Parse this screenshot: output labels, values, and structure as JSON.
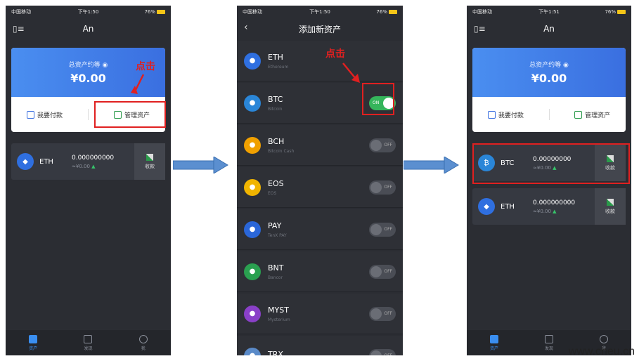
{
  "status": {
    "carrier": "中国移动",
    "time1": "下午1:50",
    "time2": "下午1:50",
    "time3": "下午1:51",
    "battery": "76%"
  },
  "screen1": {
    "title": "An",
    "asset_label": "总资产约等",
    "asset_amount": "¥0.00",
    "pay_btn": "我要付款",
    "manage_btn": "管理资产",
    "callout": "点击",
    "coin": {
      "symbol": "ETH",
      "balance": "0.000000000",
      "fiat": "≈¥0.00",
      "receive": "收款"
    }
  },
  "screen2": {
    "title": "添加新资产",
    "callout": "点击",
    "assets": [
      {
        "symbol": "ETH",
        "name": "Ethereum",
        "toggle": "",
        "color": "#2f6fe0"
      },
      {
        "symbol": "BTC",
        "name": "Bitcoin",
        "toggle": "ON",
        "color": "#2a86d8"
      },
      {
        "symbol": "BCH",
        "name": "Bitcoin Cash",
        "toggle": "OFF",
        "color": "#f0a000"
      },
      {
        "symbol": "EOS",
        "name": "EOS",
        "toggle": "OFF",
        "color": "#f0b400"
      },
      {
        "symbol": "PAY",
        "name": "TenX PAY",
        "toggle": "OFF",
        "color": "#2a66d8"
      },
      {
        "symbol": "BNT",
        "name": "Bancor",
        "toggle": "OFF",
        "color": "#2aa050"
      },
      {
        "symbol": "MYST",
        "name": "Mysterium",
        "toggle": "OFF",
        "color": "#8a40c8"
      },
      {
        "symbol": "TRX",
        "name": "",
        "toggle": "OFF",
        "color": "#5a8ac8"
      }
    ]
  },
  "screen3": {
    "title": "An",
    "asset_label": "总资产约等",
    "asset_amount": "¥0.00",
    "pay_btn": "我要付款",
    "manage_btn": "管理资产",
    "coins": [
      {
        "symbol": "BTC",
        "balance": "0.00000000",
        "fiat": "≈¥0.00",
        "receive": "收款"
      },
      {
        "symbol": "ETH",
        "balance": "0.000000000",
        "fiat": "≈¥0.00",
        "receive": "收款"
      }
    ]
  },
  "tabs": {
    "assets": "资产",
    "browser": "发现",
    "me": "我"
  },
  "watermark": "www.cheu.cn",
  "colors": {
    "accent": "#3a6fe0",
    "highlight": "#e02020",
    "up": "#36c36a"
  }
}
